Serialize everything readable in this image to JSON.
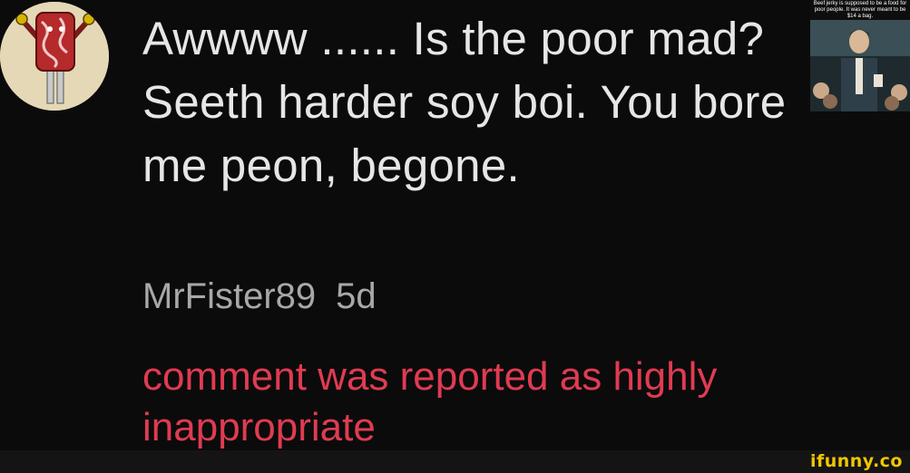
{
  "comment": {
    "text": "Awwww ...... Is the poor mad? Seeth harder soy boi. You bore me peon, begone.",
    "username": "MrFister89",
    "time": "5d",
    "report_notice": "comment was reported as highly inappropriate"
  },
  "avatar": {
    "icon": "popsicle-meat-icon"
  },
  "thumbnail": {
    "caption": "Beef jerky is supposed to be a food for poor people. It was never meant to be $14 a bag."
  },
  "watermark": {
    "text": "ifunny.co"
  },
  "colors": {
    "background": "#0b0b0b",
    "text": "#e6e6e6",
    "meta": "#a8a8a8",
    "report": "#e03b52",
    "watermark": "#f2c600"
  }
}
